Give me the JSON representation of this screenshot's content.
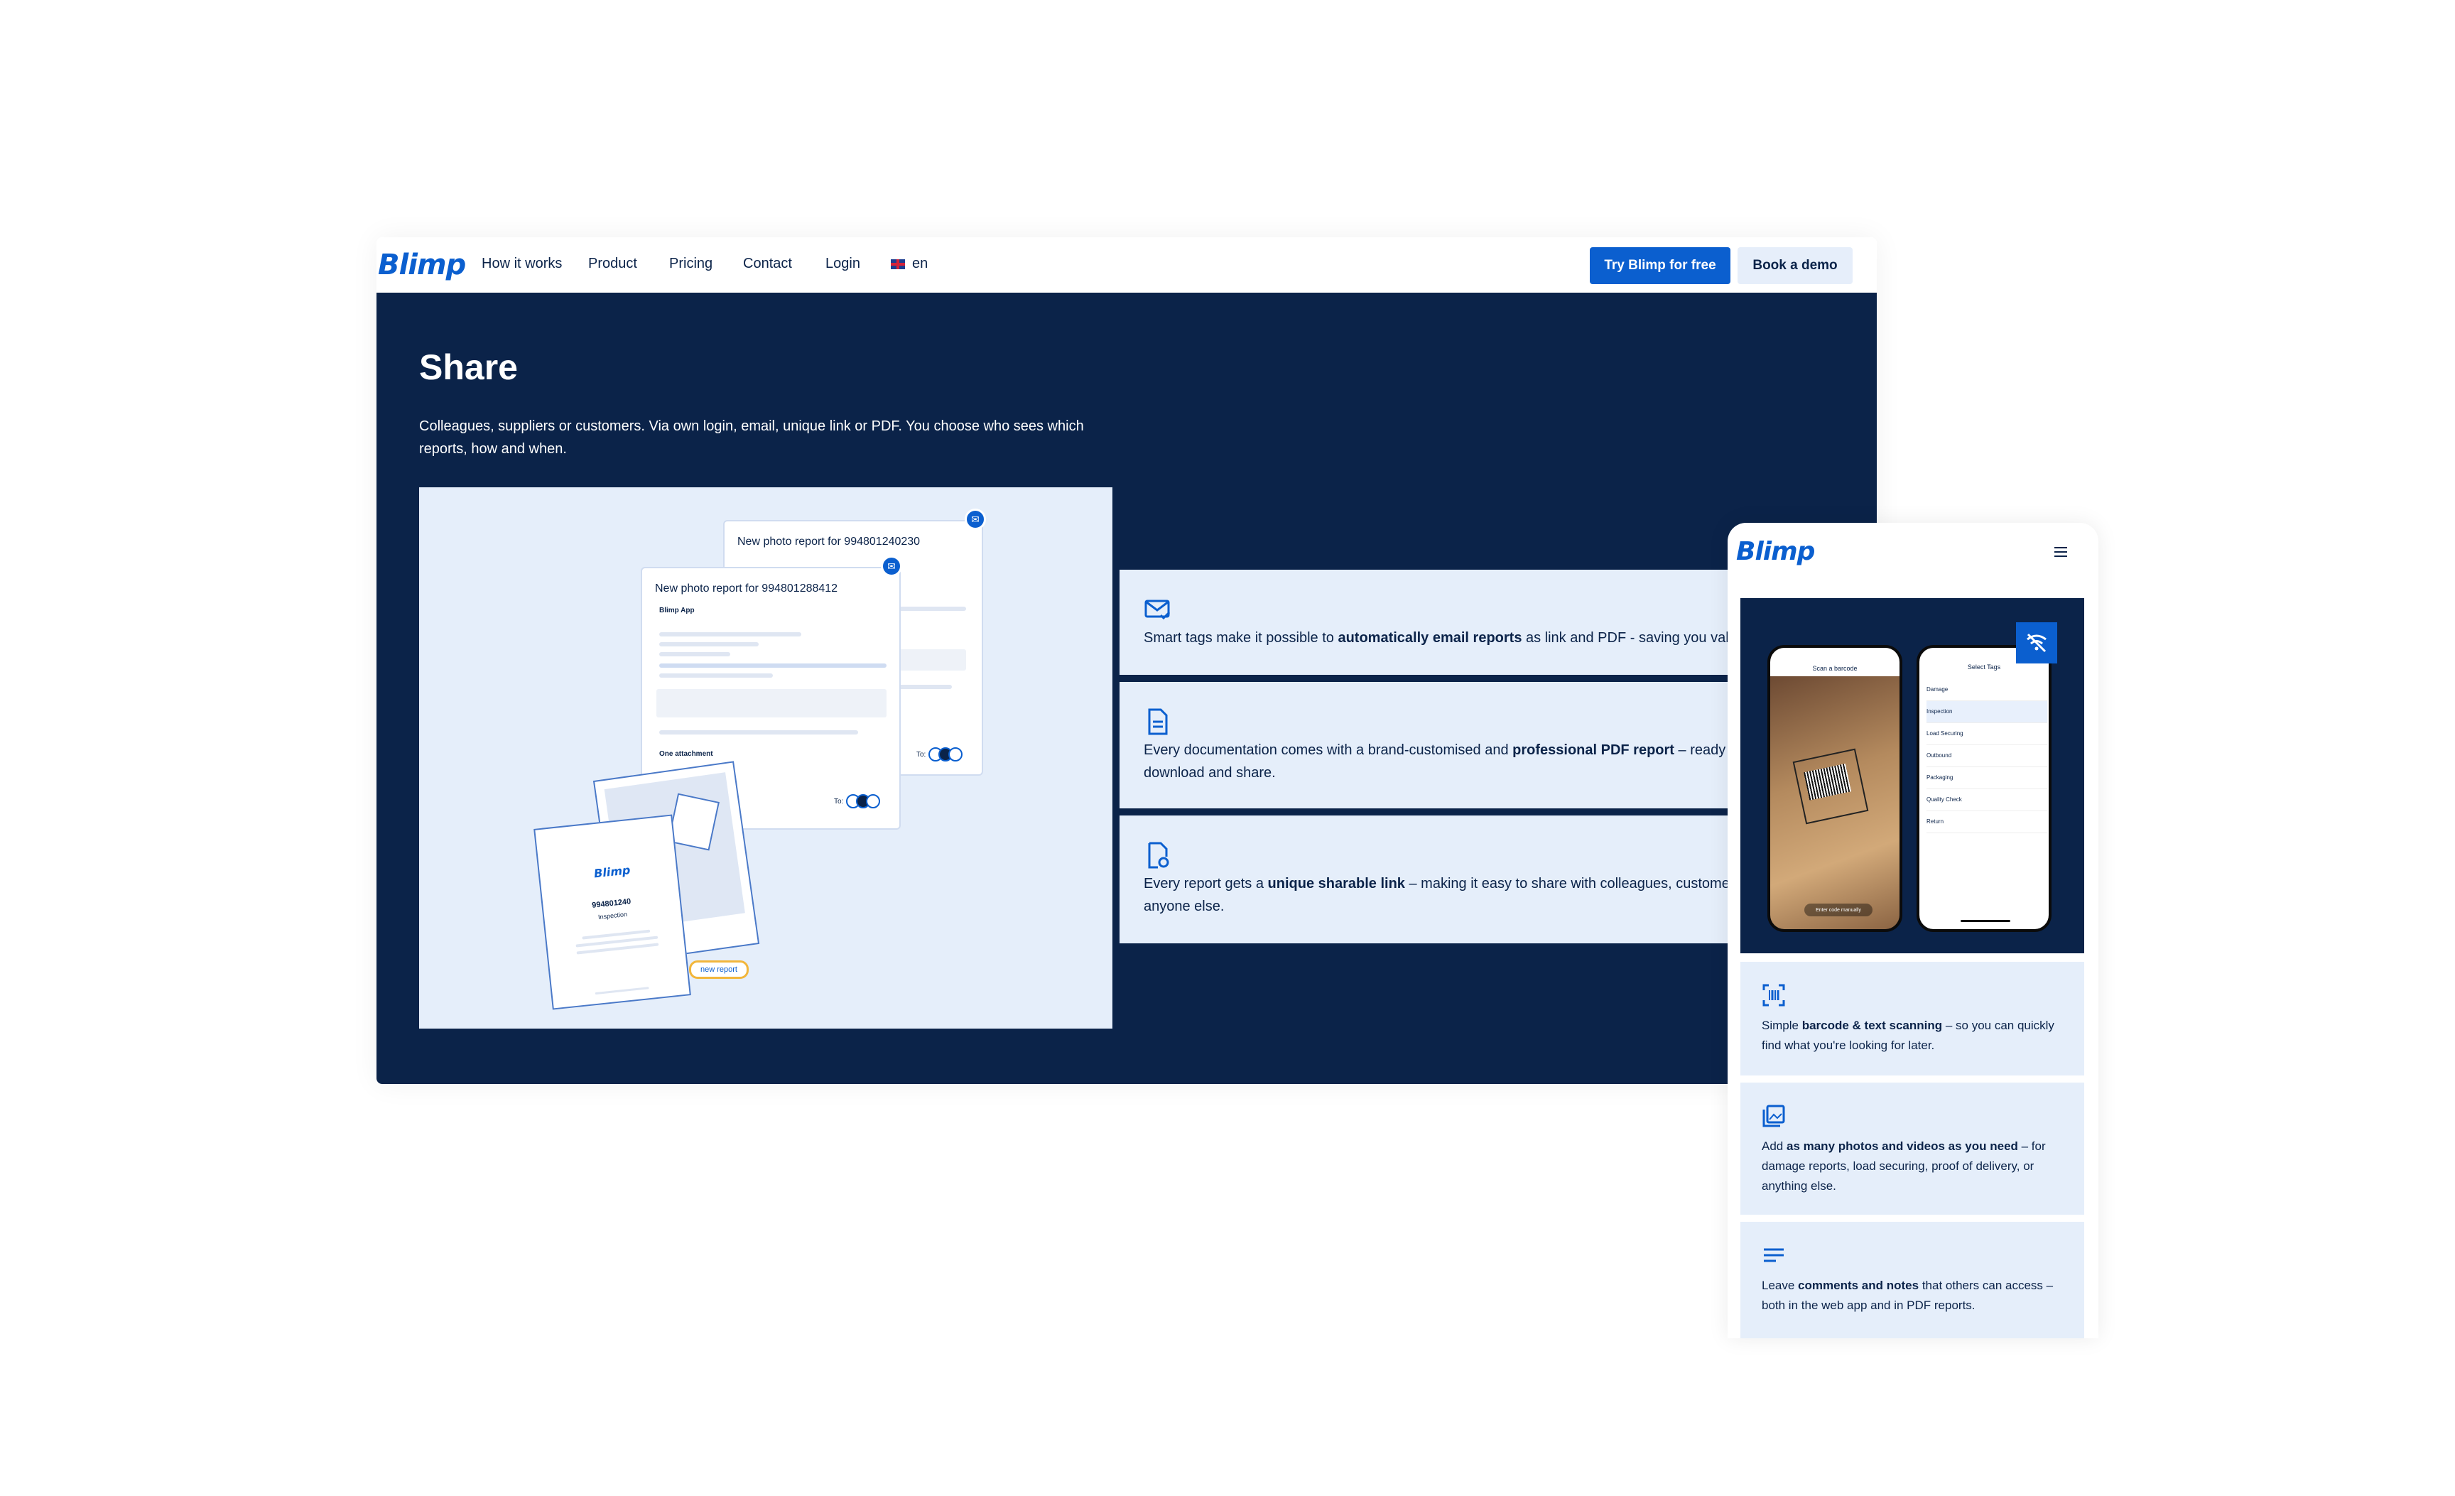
{
  "desktop": {
    "brand": "Blimp",
    "nav": [
      "How it works",
      "Product",
      "Pricing",
      "Contact",
      "Login"
    ],
    "lang": "en",
    "cta_primary": "Try Blimp for free",
    "cta_secondary": "Book a demo",
    "hero": {
      "title": "Share",
      "text": "Colleagues, suppliers or customers. Via own login, email, unique link or PDF. You choose who sees which reports, how and when."
    },
    "illustration": {
      "email_back_title": "New photo report for 994801240230",
      "email_front_title": "New photo report for 994801288412",
      "sender": "Blimp App",
      "doc_brand": "Blimp",
      "doc_number": "994801240",
      "doc_label": "Inspection",
      "new_report": "new report",
      "to_label": "To:",
      "attachment": "One attachment"
    },
    "features": [
      {
        "icon": "envelope-check-icon",
        "pre": "Smart tags make it possible to ",
        "bold": "automatically email reports",
        "post": " as link and PDF - saving you valuable time."
      },
      {
        "icon": "document-icon",
        "pre": "Every documentation comes with a brand-customised and ",
        "bold": "professional  PDF report",
        "post": " – ready to",
        "line2": "download and share."
      },
      {
        "icon": "document-link-icon",
        "pre": "Every report gets a ",
        "bold": "unique sharable link",
        "post": " – making it easy to share with colleagues, customers or",
        "line2": "anyone else."
      }
    ]
  },
  "mobile": {
    "brand": "Blimp",
    "screens": {
      "scan_title": "Scan a barcode",
      "tags_title": "Select Tags",
      "tags": [
        "Damage",
        "Inspection",
        "Load Securing",
        "Outbound",
        "Packaging",
        "Quality Check",
        "Return"
      ],
      "enter_code": "Enter code manually"
    },
    "cards": [
      {
        "icon": "barcode-scan-icon",
        "pre": "Simple ",
        "bold": "barcode & text scanning",
        "post": " – so you can quickly find what you're looking for later."
      },
      {
        "icon": "photo-stack-icon",
        "pre": "Add ",
        "bold": "as many photos and videos as you need",
        "post": " – for damage reports, load securing, proof of delivery, or anything else."
      },
      {
        "icon": "text-lines-icon",
        "pre": "Leave ",
        "bold": "comments and notes",
        "post": " that others can access – both in the web app and in PDF reports."
      }
    ]
  },
  "colors": {
    "navy": "#0b2349",
    "brand_blue": "#0b5fcf",
    "light_blue": "#e5eefa",
    "accent_yellow": "#f2b63b"
  }
}
